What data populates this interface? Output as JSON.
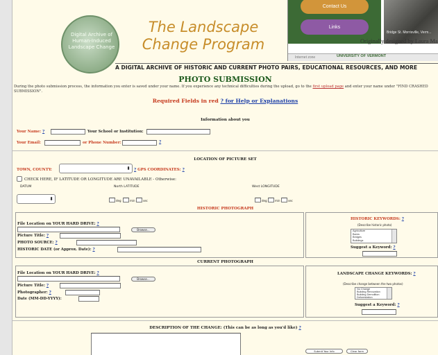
{
  "header": {
    "logo_text": "Digital Archive of Human-Induced Landscape Change",
    "title": "The Landscape Change Program",
    "tagline": "A DIGITAL ARCHIVE OF HISTORIC AND CURRENT PHOTO PAIRS, EDUCATIONAL RESOURCES, AND MORE"
  },
  "screenshot_inset": {
    "contact": "Contact Us",
    "links": "Links",
    "photo_caption": "Bridge St. Morrisville, Verm...",
    "credit": "Originally designed by Laura Mal",
    "status": "Internet zone",
    "university": "UNIVERSITY OF VERMONT"
  },
  "page": {
    "heading": "PHOTO SUBMISSION",
    "intro_text": "During the photo submission process, the information you enter is saved under your name. If you experience any technical difficulties during the upload, go to the",
    "intro_link": "first upload page",
    "intro_text2": "and enter your name under \"FIND CRASHED SUBMISSION\".",
    "required_text": "Required Fields in red",
    "help_link": "? for Help or Explanations"
  },
  "about": {
    "title": "Information about you",
    "name_label": "Your Name:",
    "school_label": "Your School or Institution:",
    "email_label": "Your Email:",
    "phone_label": "or Phone Number:",
    "help": "?"
  },
  "location": {
    "title": "LOCATION OF PICTURE SET",
    "town_label": "TOWN, COUNTY:",
    "gps_label": "GPS COORDINATES:",
    "check_text": "CHECK HERE, IF LATITUDE OR LONGITUDE ARE UNAVAILABLE - Otherwise:",
    "datum": "DATUM",
    "north_lat": "North LATITUDE",
    "west_long": "West LONGITUDE",
    "deg": "deg",
    "min": "min",
    "sec": "sec"
  },
  "historic": {
    "title": "HISTORIC PHOTOGRAPH",
    "file_label": "File Location on YOUR HARD DRIVE:",
    "browse": "Browse...",
    "picture_title": "Picture Title:",
    "photo_source": "PHOTO SOURCE:",
    "date_label": "HISTORIC DATE (or Approx. Date):",
    "keywords_title": "HISTORIC KEYWORDS:",
    "describe": "(Describe historic photo)",
    "options": [
      "Agriculture",
      "Barns",
      "Bridges",
      "Buildings"
    ],
    "suggest": "Suggest a Keyword:"
  },
  "current": {
    "title": "CURRENT PHOTOGRAPH",
    "file_label": "File Location on YOUR HARD DRIVE:",
    "browse": "Browse...",
    "picture_title": "Picture Title:",
    "photographer": "Photographer:",
    "date_label": "Date (MM-DD-YYYY):",
    "keywords_title": "LANDSCAPE CHANGE KEYWORDS:",
    "describe": "(Describe change between the two photos)",
    "options": [
      "No Change",
      "Building Renovation",
      "Building Demolition",
      "Deforestation"
    ],
    "suggest": "Suggest a Keyword:"
  },
  "description": {
    "label": "DESCRIPTION OF THE CHANGE: (This can be as long as you'd like)",
    "submit": "Submit Your Info",
    "clear": "Clear form"
  }
}
